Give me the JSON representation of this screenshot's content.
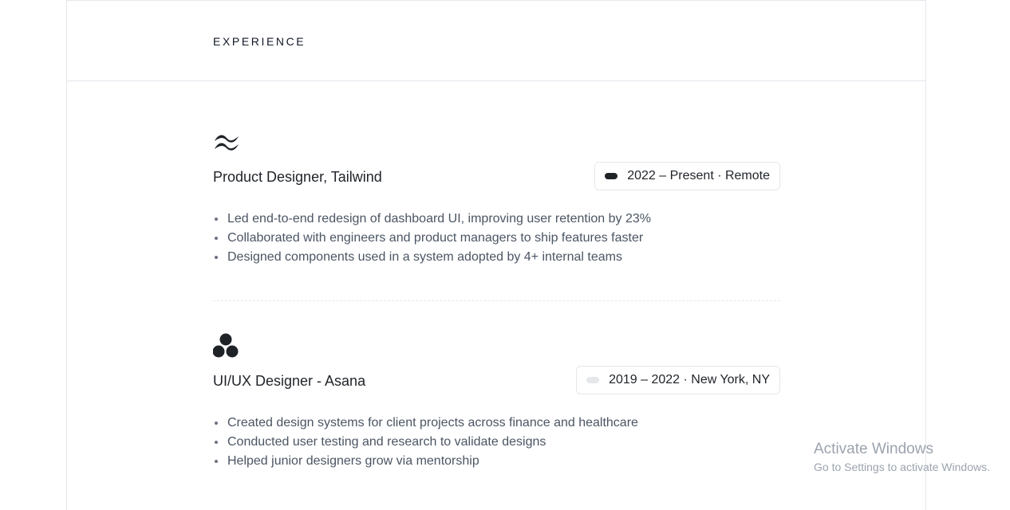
{
  "section": {
    "title": "EXPERIENCE"
  },
  "jobs": [
    {
      "logo_icon": "tailwind-logo-icon",
      "title": "Product Designer, Tailwind",
      "badge_text": "2022 – Present · Remote",
      "indicator_color": "#1f2328",
      "bullets": [
        "Led end-to-end redesign of dashboard UI, improving user retention by 23%",
        "Collaborated with engineers and product managers to ship features faster",
        "Designed components used in a system adopted by 4+ internal teams"
      ]
    },
    {
      "logo_icon": "asana-logo-icon",
      "title": "UI/UX Designer - Asana",
      "badge_text": "2019 – 2022 · New York, NY",
      "indicator_color": "#e5e7eb",
      "bullets": [
        "Created design systems for client projects across finance and healthcare",
        "Conducted user testing and research to validate designs",
        "Helped junior designers grow via mentorship"
      ]
    }
  ],
  "watermark": {
    "title": "Activate Windows",
    "subtitle": "Go to Settings to activate Windows."
  }
}
